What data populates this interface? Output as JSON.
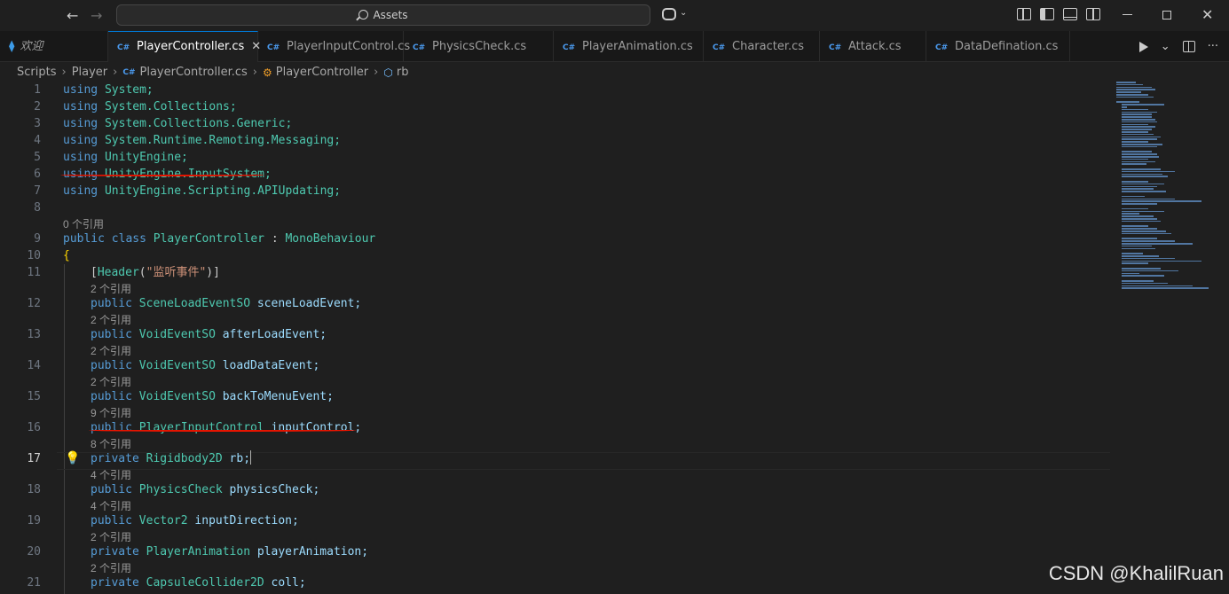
{
  "titlebar": {
    "search_label": "Assets"
  },
  "tabs": [
    {
      "label": "欢迎",
      "kind": "welcome"
    },
    {
      "label": "PlayerController.cs",
      "active": true
    },
    {
      "label": "PlayerInputControl.cs"
    },
    {
      "label": "PhysicsCheck.cs"
    },
    {
      "label": "PlayerAnimation.cs"
    },
    {
      "label": "Character.cs"
    },
    {
      "label": "Attack.cs"
    },
    {
      "label": "DataDefination.cs"
    }
  ],
  "breadcrumb": [
    "Scripts",
    "Player",
    "PlayerController.cs",
    "PlayerController",
    "rb"
  ],
  "editor": {
    "line_numbers": [
      "1",
      "2",
      "3",
      "4",
      "5",
      "6",
      "7",
      "8",
      "9",
      "10",
      "11",
      "12",
      "13",
      "14",
      "15",
      "16",
      "17",
      "18",
      "19",
      "20",
      "21"
    ],
    "current_line": "17",
    "lines": {
      "l1": {
        "kw": "using",
        "rest": "System;"
      },
      "l2": {
        "kw": "using",
        "rest": "System.Collections;"
      },
      "l3": {
        "kw": "using",
        "rest": "System.Collections.Generic;"
      },
      "l4": {
        "kw": "using",
        "rest": "System.Runtime.Remoting.Messaging;"
      },
      "l5": {
        "kw": "using",
        "rest": "UnityEngine;"
      },
      "l6": {
        "kw": "using",
        "rest": "UnityEngine.InputSystem;"
      },
      "l7": {
        "kw": "using",
        "rest": "UnityEngine.Scripting.APIUpdating;"
      },
      "l9": {
        "kw1": "public",
        "kw2": "class",
        "name": "PlayerController",
        "colon": ":",
        "base": "MonoBehaviour"
      },
      "l10": {
        "brace": "{"
      },
      "l11": {
        "open": "[",
        "attr": "Header",
        "lp": "(",
        "str": "\"监听事件\"",
        "rp": ")",
        "close": "]"
      },
      "l12": {
        "mod": "public",
        "type": "SceneLoadEventSO",
        "name": "sceneLoadEvent;"
      },
      "l13": {
        "mod": "public",
        "type": "VoidEventSO",
        "name": "afterLoadEvent;"
      },
      "l14": {
        "mod": "public",
        "type": "VoidEventSO",
        "name": "loadDataEvent;"
      },
      "l15": {
        "mod": "public",
        "type": "VoidEventSO",
        "name": "backToMenuEvent;"
      },
      "l16": {
        "mod": "public",
        "type": "PlayerInputControl",
        "name": "inputControl;"
      },
      "l17": {
        "mod": "private",
        "type": "Rigidbody2D",
        "name": "rb;"
      },
      "l18": {
        "mod": "public",
        "type": "PhysicsCheck",
        "name": "physicsCheck;"
      },
      "l19": {
        "mod": "public",
        "type": "Vector2",
        "name": "inputDirection;"
      },
      "l20": {
        "mod": "private",
        "type": "PlayerAnimation",
        "name": "playerAnimation;"
      },
      "l21": {
        "mod": "private",
        "type": "CapsuleCollider2D",
        "name": "coll;"
      }
    },
    "codelens": {
      "c9": "0 个引用",
      "c12": "2 个引用",
      "c13": "2 个引用",
      "c14": "2 个引用",
      "c15": "2 个引用",
      "c16": "9 个引用",
      "c17": "8 个引用",
      "c18": "4 个引用",
      "c19": "4 个引用",
      "c20": "2 个引用",
      "c21": "2 个引用"
    }
  },
  "watermark": "CSDN @KhalilRuan",
  "colors": {
    "keyword": "#569cd6",
    "type": "#4ec9b0",
    "identifier": "#9cdcfe",
    "string": "#ce9178",
    "annotation_underline": "#e51400"
  }
}
